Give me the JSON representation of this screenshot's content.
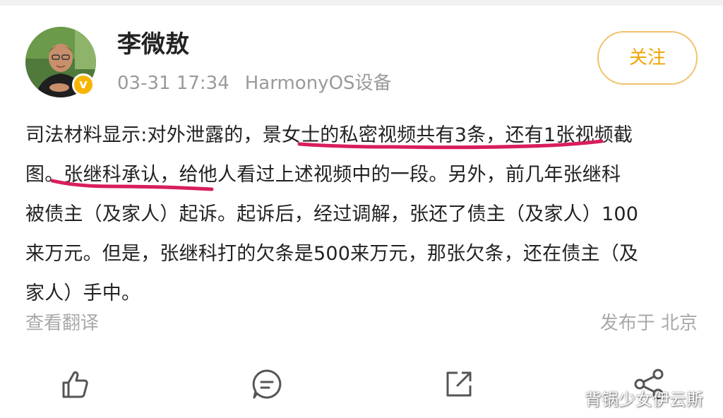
{
  "post": {
    "author": "李微敖",
    "time": "03-31 17:34",
    "device": "HarmonyOS设备",
    "follow_label": "关注",
    "verified_badge": "v",
    "body_lines": [
      "司法材料显示:对外泄露的，景女士的私密视频共有3条，还有1张视频截",
      "图。张继科承认，给他人看过上述视频中的一段。另外，前几年张继科",
      "被债主（及家人）起诉。起诉后，经过调解，张还了债主（及家人）100",
      "来万元。但是，张继科打的欠条是500来万元，那张欠条，还在债主（及",
      "家人）手中。"
    ],
    "translate_label": "查看翻译",
    "location": "发布于 北京"
  },
  "actions": {
    "like_icon": "thumbs-up-icon",
    "comment_icon": "comment-icon",
    "repost_icon": "repost-icon",
    "share_icon": "share-icon"
  },
  "watermark": {
    "text": "背锅少女伊云斯"
  },
  "colors": {
    "accent": "#f0a300",
    "underline": "#d81e5b",
    "muted_text": "#9a9a9a",
    "body_text": "#222222"
  }
}
